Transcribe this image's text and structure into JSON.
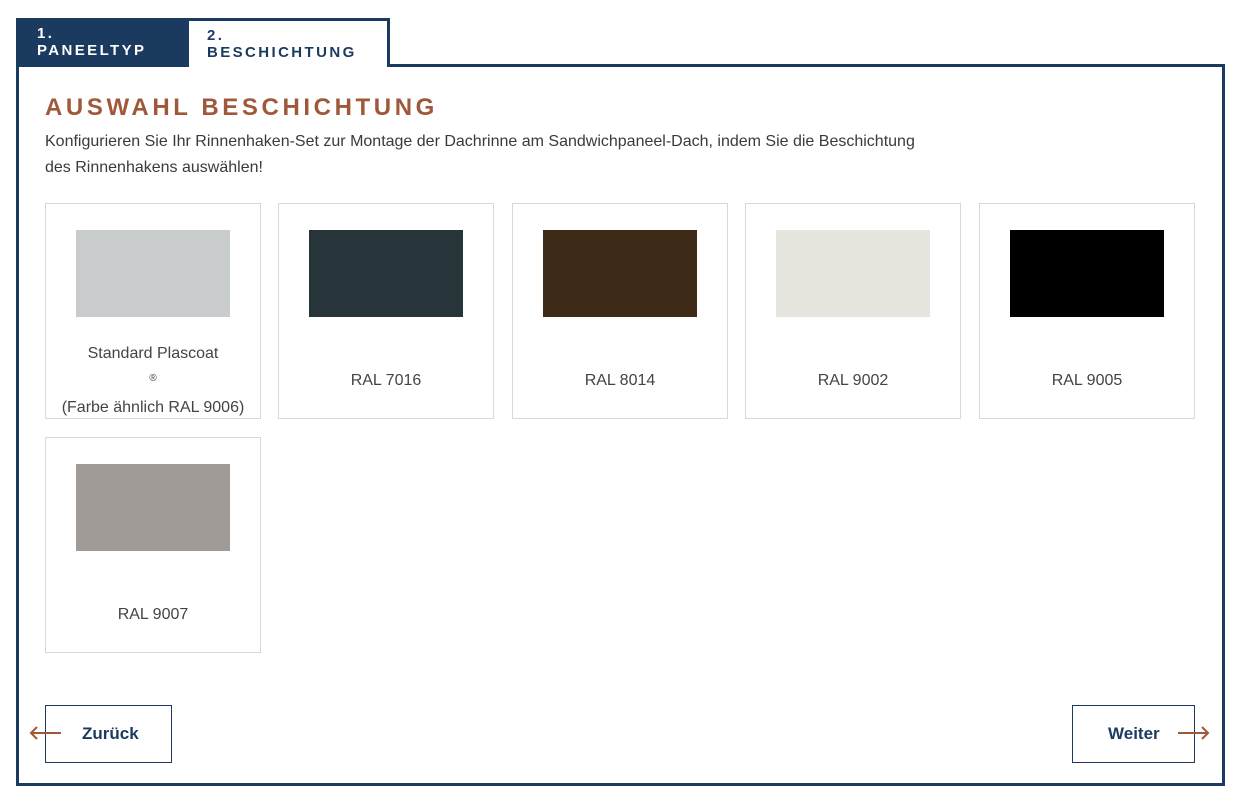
{
  "tabs": [
    {
      "label": "1. PANEELTYP",
      "active": false
    },
    {
      "label": "2. BESCHICHTUNG",
      "active": true
    }
  ],
  "section": {
    "title": "AUSWAHL BESCHICHTUNG",
    "description_line1": "Konfigurieren Sie Ihr Rinnenhaken-Set zur Montage der Dachrinne am Sandwichpaneel-Dach, indem Sie die Beschichtung",
    "description_line2": "des Rinnenhakens auswählen!"
  },
  "coatings": [
    {
      "label_line1": "Standard Plascoat",
      "registered_mark": "®",
      "label_line2": "(Farbe ähnlich RAL 9006)",
      "color": "#c9cccd"
    },
    {
      "label": "RAL 7016",
      "color": "#27353b"
    },
    {
      "label": "RAL 8014",
      "color": "#3d2b17"
    },
    {
      "label": "RAL 9002",
      "color": "#e6e6de"
    },
    {
      "label": "RAL 9005",
      "color": "#000000"
    },
    {
      "label": "RAL 9007",
      "color": "#a19b97"
    }
  ],
  "navigation": {
    "back_label": "Zurück",
    "next_label": "Weiter",
    "back_icon": "arrow-left-icon",
    "next_icon": "arrow-right-icon"
  },
  "colors": {
    "primary_navy": "#1b3a5f",
    "accent_brown": "#a0583a"
  }
}
